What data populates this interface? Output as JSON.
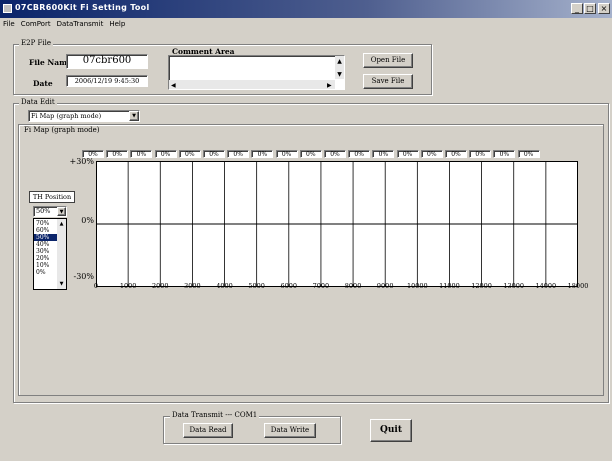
{
  "window": {
    "title": "07CBR600Kit Fi Setting Tool",
    "controls": [
      "_",
      "□",
      "×"
    ]
  },
  "menu": [
    "File",
    "ComPort",
    "DataTransmit",
    "Help"
  ],
  "e2p_file": {
    "legend": "E2P File",
    "file_name_label": "File Name",
    "file_name_value": "07cbr600",
    "date_label": "Date",
    "date_value": "2006/12/19 9:45:30",
    "comment_label": "Comment Area",
    "open_label": "Open File",
    "save_label": "Save File"
  },
  "data_edit": {
    "legend": "Data Edit",
    "mode_selected": "Fi Map (graph mode)"
  },
  "fi_map": {
    "legend": "Fi Map (graph mode)",
    "cell_values": [
      "0%",
      "0%",
      "0%",
      "0%",
      "0%",
      "0%",
      "0%",
      "0%",
      "0%",
      "0%",
      "0%",
      "0%",
      "0%",
      "0%",
      "0%",
      "0%",
      "0%",
      "0%",
      "0%"
    ],
    "y_labels": [
      "+30%",
      "0%",
      "-30%"
    ],
    "x_ticks": [
      "0",
      "1000",
      "2000",
      "3000",
      "4000",
      "5000",
      "6000",
      "7000",
      "8000",
      "9000",
      "10000",
      "11000",
      "12000",
      "13000",
      "14000",
      "18000"
    ],
    "th_position": {
      "label": "TH Position",
      "selected": "50%",
      "options": [
        "70%",
        "60%",
        "50%",
        "40%",
        "30%",
        "20%",
        "10%",
        "0%"
      ]
    }
  },
  "data_transmit": {
    "legend": "Data Transmit --- COM1",
    "read_label": "Data Read",
    "write_label": "Data Write"
  },
  "quit_label": "Quit",
  "colors": {
    "title_start": "#0a246a",
    "face": "#d4d0c8",
    "highlight": "#0a246a"
  }
}
